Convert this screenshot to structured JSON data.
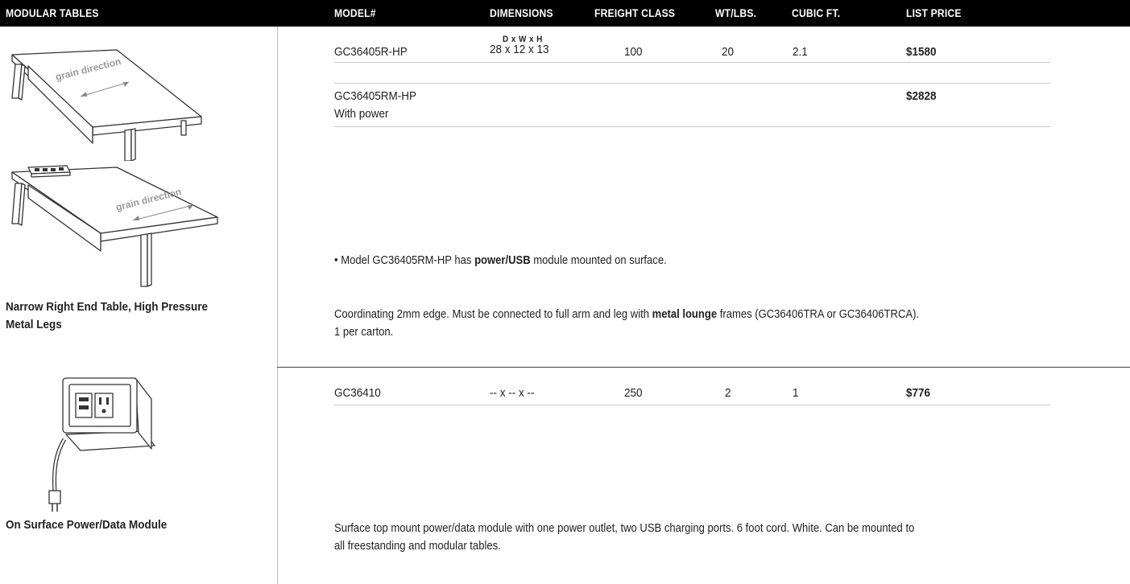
{
  "header": {
    "section": "MODULAR TABLES",
    "columns": [
      "MODEL#",
      "DIMENSIONS",
      "FREIGHT CLASS",
      "WT/LBS.",
      "CUBIC FT.",
      "LIST PRICE"
    ]
  },
  "images": {
    "grain_label": "grain direction"
  },
  "product1": {
    "label_line1": "Narrow Right End Table, High Pressure",
    "label_line2": "Metal Legs",
    "dim_header": "D x W x H",
    "rows": [
      {
        "model": "GC36405R-HP",
        "dimensions": "28 x 12 x 13",
        "freight": "100",
        "weight": "20",
        "cubic": "2.1",
        "price": "$1580"
      },
      {
        "model": "GC36405RM-HP",
        "model_line2": "With power",
        "price": "$2828"
      }
    ],
    "note_prefix": "• Model GC36405RM-HP has ",
    "note_bold": "power/USB",
    "note_suffix": " module mounted on surface.",
    "desc_a": "Coordinating 2mm edge.  Must be connected to full arm and leg with ",
    "desc_bold": "metal lounge",
    "desc_b": " frames (GC36406TRA or GC36406TRCA).",
    "desc_line2": "1 per carton."
  },
  "product2": {
    "label": "On Surface Power/Data Module",
    "row": {
      "model": "GC36410",
      "dimensions": "-- x -- x --",
      "freight": "250",
      "weight": "2",
      "cubic": "1",
      "price": "$776"
    },
    "desc_line1": "Surface top mount power/data module with one power outlet, two USB charging ports. 6 foot cord. White. Can be mounted to",
    "desc_line2": "all freestanding and modular tables."
  }
}
